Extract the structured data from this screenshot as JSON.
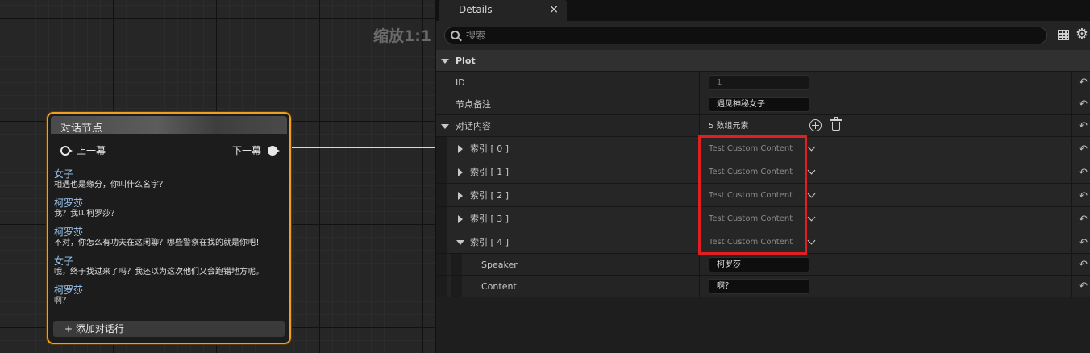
{
  "graph": {
    "zoom_label": "缩放1:1",
    "node": {
      "title": "对话节点",
      "prev_pin": "上一幕",
      "next_pin": "下一幕",
      "lines": [
        {
          "speaker": "女子",
          "content": "相遇也是缘分，你叫什么名字？"
        },
        {
          "speaker": "柯罗莎",
          "content": "我？我叫柯罗莎？"
        },
        {
          "speaker": "柯罗莎",
          "content": "不对，你怎么有功夫在这闲聊？哪些警察在找的就是你吧！"
        },
        {
          "speaker": "女子",
          "content": "哦，终于找过来了吗？我还以为这次他们又会跑错地方呢。"
        },
        {
          "speaker": "柯罗莎",
          "content": "啊？"
        }
      ],
      "add_line_label": "+ 添加对话行"
    }
  },
  "details": {
    "tab_label": "Details",
    "tab_close": "×",
    "search_placeholder": "搜索",
    "category": "Plot",
    "id_label": "ID",
    "id_value": "1",
    "note_label": "节点备注",
    "note_value": "遇见神秘女子",
    "array_label": "对话内容",
    "array_count": "5 数组元素",
    "elements": [
      {
        "label": "索引 [ 0 ]",
        "value": "Test Custom Content"
      },
      {
        "label": "索引 [ 1 ]",
        "value": "Test Custom Content"
      },
      {
        "label": "索引 [ 2 ]",
        "value": "Test Custom Content"
      },
      {
        "label": "索引 [ 3 ]",
        "value": "Test Custom Content"
      },
      {
        "label": "索引 [ 4 ]",
        "value": "Test Custom Content"
      }
    ],
    "speaker_label": "Speaker",
    "speaker_value": "柯罗莎",
    "content_label": "Content",
    "content_value": "啊？",
    "reset_glyph": "↶",
    "gear_glyph": "⚙"
  },
  "colors": {
    "node_border": "#f0a020",
    "speaker_text": "#9ec8f0",
    "highlight": "#e02020"
  }
}
